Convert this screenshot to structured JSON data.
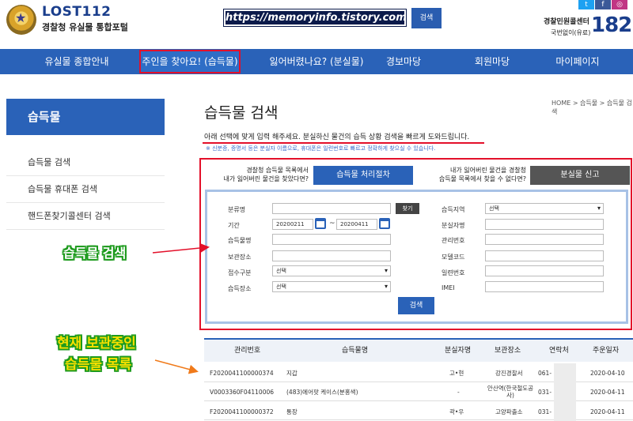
{
  "header": {
    "logo_title": "LOST112",
    "logo_subtitle": "경찰청 유실물 통합포털",
    "watermark": "https://memoryinfo.tistory.com",
    "search_button": "검색",
    "callcenter_label": "경찰민원콜센터",
    "callcenter_sub": "국번없이(유료)",
    "callcenter_number": "182",
    "sns_icons": [
      "twitter-icon",
      "facebook-icon",
      "instagram-icon"
    ]
  },
  "nav": {
    "items": [
      {
        "label": "유실물 종합안내"
      },
      {
        "label": "주인을 찾아요! (습득물)"
      },
      {
        "label": "잃어버렸나요? (분실물)"
      },
      {
        "label": "경보마당"
      },
      {
        "label": "회원마당"
      },
      {
        "label": "마이페이지"
      }
    ],
    "active_index": 1
  },
  "sidebar": {
    "title": "습득물",
    "items": [
      {
        "label": "습득물 검색"
      },
      {
        "label": "습득물 휴대폰 검색"
      },
      {
        "label": "핸드폰찾기콜센터 검색"
      }
    ]
  },
  "main": {
    "title": "습득물 검색",
    "breadcrumb": "HOME > 습득물 > 습득물 검색",
    "description": "아래 선택에 맞게 입력 해주세요. 분실하신 물건의 습득 상황 검색을 빠르게 도와드립니다.",
    "note": "※ 신분증, 증명서 등은 분실자 이름으로, 휴대폰은 일련번호로 빠르고 정확하게 찾으실 수 있습니다."
  },
  "actions": {
    "lost_text_1": "경찰청 습득물 목록에서",
    "lost_text_2": "내가 잃어버린 물건을 찾았다면?",
    "procedure_button": "습득물 처리절차",
    "report_text_1": "내가 잃어버린 물건을 경찰청",
    "report_text_2": "습득물 목록에서 찾을 수 없다면?",
    "report_button": "분실물 신고"
  },
  "form": {
    "category_label": "분류명",
    "find_button": "찾기",
    "period_label": "기간",
    "date_from": "20200211",
    "date_to": "20200411",
    "item_name_label": "습득물명",
    "storage_label": "보관장소",
    "receipt_type_label": "접수구분",
    "receipt_type_value": "선택",
    "found_place_label": "습득장소",
    "found_place_value": "선택",
    "region_label": "습득지역",
    "region_value": "선택",
    "lost_person_label": "분실자명",
    "mgmt_no_label": "관리번호",
    "model_code_label": "모델코드",
    "serial_label": "일련번호",
    "imei_label": "IMEI",
    "submit_button": "검색"
  },
  "annotations": {
    "search_label": "습득물 검색",
    "list_label_1": "현재 보관중인",
    "list_label_2": "습득물 목록"
  },
  "table": {
    "headers": [
      "관리번호",
      "습득물명",
      "분실자명",
      "보관장소",
      "연락처",
      "주운일자"
    ],
    "rows": [
      {
        "id": "F2020041100000374",
        "name": "지갑",
        "person": "고•현",
        "place": "강진경찰서",
        "phone": "061-",
        "date": "2020-04-10"
      },
      {
        "id": "V0003360F04110006",
        "name": "(483)에어팟 케이스(분홍색)",
        "person": "-",
        "place": "안산역(한국철도공사)",
        "phone": "031-",
        "date": "2020-04-11"
      },
      {
        "id": "F2020041100000372",
        "name": "통장",
        "person": "곽•우",
        "place": "고양파출소",
        "phone": "031-",
        "date": "2020-04-11"
      }
    ]
  },
  "colors": {
    "brand_blue": "#2a62b8",
    "highlight_red": "#e3102a",
    "annotation_green": "#1c9a1c",
    "annotation_yellow": "#f7e000"
  }
}
